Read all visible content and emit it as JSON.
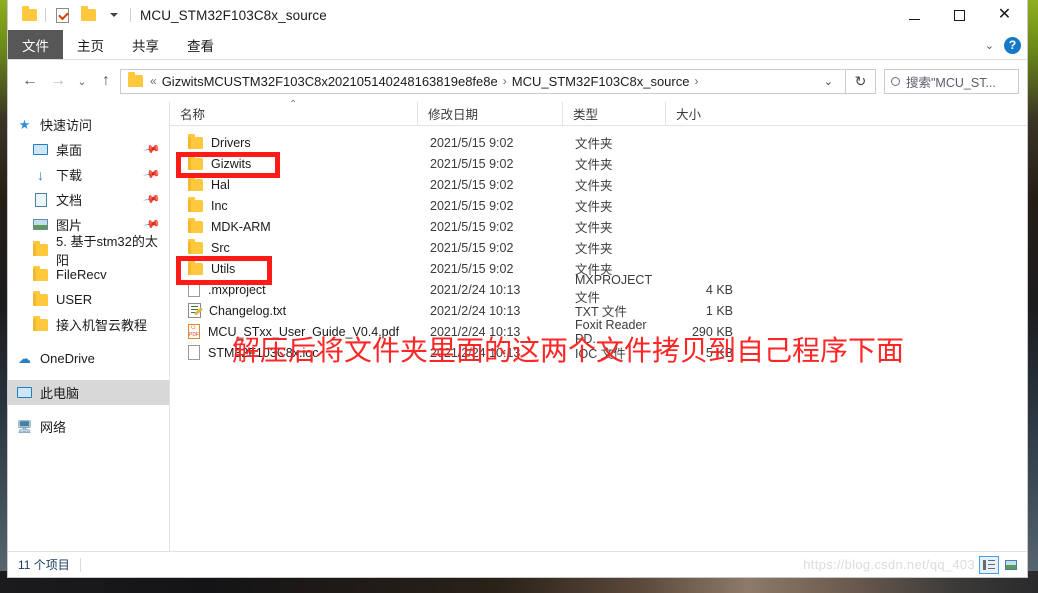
{
  "window": {
    "title": "MCU_STM32F103C8x_source",
    "controls": {
      "minimize": "—",
      "maximize": "□",
      "close": "✕"
    }
  },
  "quick_access_toolbar": {
    "folder_label": "folder-icon",
    "properties_label": "properties-icon",
    "new_folder_label": "new-folder-icon",
    "dropdown_label": "▾"
  },
  "ribbon": {
    "tabs": [
      {
        "label": "文件",
        "active": true
      },
      {
        "label": "主页",
        "active": false
      },
      {
        "label": "共享",
        "active": false
      },
      {
        "label": "查看",
        "active": false
      }
    ],
    "expand_chevron": "⌄",
    "help_label": "?"
  },
  "navigation": {
    "back": "←",
    "forward": "→",
    "recent_dropdown": "⌄",
    "up": "↑",
    "breadcrumb": [
      "«",
      "GizwitsMCUSTM32F103C8x202105140248163819e8fe8e",
      "MCU_STM32F103C8x_source"
    ],
    "breadcrumb_sep": "›",
    "address_dropdown": "⌄",
    "refresh": "↻"
  },
  "search": {
    "placeholder": "搜索\"MCU_ST...",
    "value": "搜索\"MCU_ST...",
    "icon": "search-icon"
  },
  "sidebar": {
    "items": [
      {
        "label": "快速访问",
        "icon": "star-icon",
        "indent": 0,
        "pinned": false,
        "selected": false
      },
      {
        "label": "桌面",
        "icon": "desktop-icon",
        "indent": 1,
        "pinned": true,
        "selected": false
      },
      {
        "label": "下载",
        "icon": "download-icon",
        "indent": 1,
        "pinned": true,
        "selected": false
      },
      {
        "label": "文档",
        "icon": "documents-icon",
        "indent": 1,
        "pinned": true,
        "selected": false
      },
      {
        "label": "图片",
        "icon": "pictures-icon",
        "indent": 1,
        "pinned": true,
        "selected": false
      },
      {
        "label": "5. 基于stm32的太阳",
        "icon": "folder-icon",
        "indent": 1,
        "pinned": false,
        "selected": false
      },
      {
        "label": "FileRecv",
        "icon": "folder-icon",
        "indent": 1,
        "pinned": false,
        "selected": false
      },
      {
        "label": "USER",
        "icon": "folder-icon",
        "indent": 1,
        "pinned": false,
        "selected": false
      },
      {
        "label": "接入机智云教程",
        "icon": "folder-icon",
        "indent": 1,
        "pinned": false,
        "selected": false
      },
      {
        "label": "OneDrive",
        "icon": "cloud-icon",
        "indent": 0,
        "pinned": false,
        "selected": false
      },
      {
        "label": "此电脑",
        "icon": "computer-icon",
        "indent": 0,
        "pinned": false,
        "selected": true
      },
      {
        "label": "网络",
        "icon": "network-icon",
        "indent": 0,
        "pinned": false,
        "selected": false
      }
    ],
    "pin_glyph": "📌"
  },
  "file_list": {
    "columns": [
      {
        "label": "名称",
        "key": "name"
      },
      {
        "label": "修改日期",
        "key": "date"
      },
      {
        "label": "类型",
        "key": "type"
      },
      {
        "label": "大小",
        "key": "size"
      }
    ],
    "sort_indicator": "⌃",
    "rows": [
      {
        "name": "Drivers",
        "date": "2021/5/15 9:02",
        "type": "文件夹",
        "size": "",
        "icon": "folder-icon"
      },
      {
        "name": "Gizwits",
        "date": "2021/5/15 9:02",
        "type": "文件夹",
        "size": "",
        "icon": "folder-icon"
      },
      {
        "name": "Hal",
        "date": "2021/5/15 9:02",
        "type": "文件夹",
        "size": "",
        "icon": "folder-icon"
      },
      {
        "name": "Inc",
        "date": "2021/5/15 9:02",
        "type": "文件夹",
        "size": "",
        "icon": "folder-icon"
      },
      {
        "name": "MDK-ARM",
        "date": "2021/5/15 9:02",
        "type": "文件夹",
        "size": "",
        "icon": "folder-icon"
      },
      {
        "name": "Src",
        "date": "2021/5/15 9:02",
        "type": "文件夹",
        "size": "",
        "icon": "folder-icon"
      },
      {
        "name": "Utils",
        "date": "2021/5/15 9:02",
        "type": "文件夹",
        "size": "",
        "icon": "folder-icon"
      },
      {
        "name": ".mxproject",
        "date": "2021/2/24 10:13",
        "type": "MXPROJECT 文件",
        "size": "4 KB",
        "icon": "blank-file-icon"
      },
      {
        "name": "Changelog.txt",
        "date": "2021/2/24 10:13",
        "type": "TXT 文件",
        "size": "1 KB",
        "icon": "text-file-icon"
      },
      {
        "name": "MCU_STxx_User_Guide_V0.4.pdf",
        "date": "2021/2/24 10:13",
        "type": "Foxit Reader PD...",
        "size": "290 KB",
        "icon": "pdf-file-icon"
      },
      {
        "name": "STM32F103C8x.ioc",
        "date": "2021/2/24 10:13",
        "type": "IOC 文件",
        "size": "5 KB",
        "icon": "blank-file-icon"
      }
    ]
  },
  "annotations": {
    "red_note": "解压后将文件夹里面的这两个文件拷贝到自己程序下面",
    "highlight_boxes": [
      "Gizwits",
      "Utils"
    ],
    "color": "#ff1a1a"
  },
  "status_bar": {
    "item_count": "11 个项目",
    "watermark": "https://blog.csdn.net/qq_403",
    "views": [
      {
        "name": "details-view",
        "selected": true
      },
      {
        "name": "large-icons-view",
        "selected": false
      }
    ]
  },
  "colors": {
    "accent": "#0078d7",
    "folder": "#ffc83d",
    "annotation": "#ff1a1a",
    "file_tab": "#575757"
  }
}
